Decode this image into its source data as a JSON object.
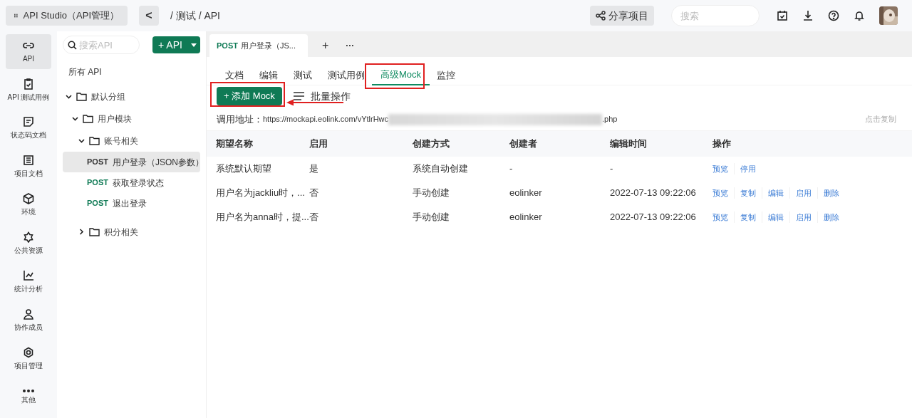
{
  "topbar": {
    "app_button": "API Studio（API管理）",
    "back": "<",
    "breadcrumb": "/ 测试 / API",
    "share_button": "分享项目",
    "search": {
      "placeholder": "搜索"
    }
  },
  "rail": [
    {
      "label": "API",
      "selected": true
    },
    {
      "label": "API 测试用例",
      "selected": false
    },
    {
      "label": "状态码文档",
      "selected": false
    },
    {
      "label": "项目文档",
      "selected": false
    },
    {
      "label": "环境",
      "selected": false
    },
    {
      "label": "公共资源",
      "selected": false
    },
    {
      "label": "统计分析",
      "selected": false
    },
    {
      "label": "协作成员",
      "selected": false
    },
    {
      "label": "项目管理",
      "selected": false
    },
    {
      "label": "其他",
      "selected": false
    }
  ],
  "tree_panel": {
    "search": {
      "placeholder": "搜索API"
    },
    "add_button": "+ API",
    "all_label": "所有 API",
    "tree": [
      {
        "kind": "folder",
        "label": "默认分组",
        "expanded": true,
        "children": [
          {
            "kind": "folder",
            "label": "用户模块",
            "expanded": true,
            "children": [
              {
                "kind": "folder",
                "label": "账号相关",
                "expanded": true,
                "children": [
                  {
                    "kind": "api",
                    "method": "POST",
                    "label": "用户登录（JSON参数）",
                    "selected": true
                  },
                  {
                    "kind": "api",
                    "method": "POST",
                    "label": "获取登录状态",
                    "selected": false
                  },
                  {
                    "kind": "api",
                    "method": "POST",
                    "label": "退出登录",
                    "selected": false
                  }
                ]
              },
              {
                "kind": "folder",
                "label": "积分相关",
                "expanded": false
              }
            ]
          }
        ]
      }
    ]
  },
  "doc_tab": {
    "method": "POST",
    "label": "用户登录（JS...",
    "add": "+",
    "more": "···"
  },
  "tabs": [
    {
      "label": "文档",
      "selected": false
    },
    {
      "label": "编辑",
      "selected": false
    },
    {
      "label": "测试",
      "selected": false
    },
    {
      "label": "测试用例",
      "selected": false
    },
    {
      "label": "高级Mock",
      "selected": true
    },
    {
      "label": "监控",
      "selected": false
    }
  ],
  "toolbar": {
    "add_mock": "+ 添加 Mock",
    "batch": "批量操作"
  },
  "address": {
    "label": "调用地址：",
    "url_start": "https://mockapi.eolink.com/vYtlrHwc",
    "url_end": ".php",
    "copy": "点击复制"
  },
  "table": {
    "columns": [
      "期望名称",
      "启用",
      "创建方式",
      "创建者",
      "编辑时间",
      "操作"
    ],
    "rows": [
      {
        "cells": [
          "系统默认期望",
          "是",
          "系统自动创建",
          "-",
          "-"
        ],
        "actions": [
          "预览",
          "停用"
        ]
      },
      {
        "cells": [
          "用户名为jackliu时，...",
          "否",
          "手动创建",
          "eolinker",
          "2022-07-13 09:22:06"
        ],
        "actions": [
          "预览",
          "复制",
          "编辑",
          "启用",
          "删除"
        ]
      },
      {
        "cells": [
          "用户名为anna时，提...",
          "否",
          "手动创建",
          "eolinker",
          "2022-07-13 09:22:06"
        ],
        "actions": [
          "预览",
          "复制",
          "编辑",
          "启用",
          "删除"
        ]
      }
    ]
  }
}
